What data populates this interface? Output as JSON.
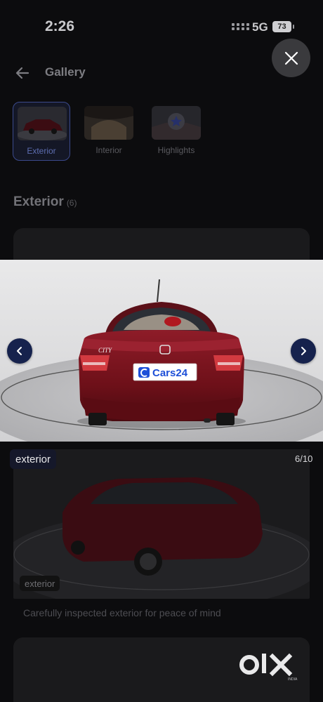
{
  "status_bar": {
    "time": "2:26",
    "network": "5G",
    "battery": "73"
  },
  "header": {
    "title": "Gallery"
  },
  "tabs": [
    {
      "label": "Exterior",
      "active": true
    },
    {
      "label": "Interior",
      "active": false
    },
    {
      "label": "Highlights",
      "active": false
    }
  ],
  "section": {
    "title": "Exterior",
    "count": "(6)"
  },
  "viewer": {
    "plate_text": "Cars24",
    "badge_text": "CITY",
    "category": "exterior",
    "counter": "6/10"
  },
  "card": {
    "badge": "exterior",
    "caption": "Carefully inspected exterior for peace of mind"
  },
  "brand": {
    "logo_text": "OLX",
    "logo_subtext": "INDIA"
  },
  "colors": {
    "accent": "#16224d",
    "car_red": "#7a1420",
    "overlay": "#0c0c0e"
  }
}
